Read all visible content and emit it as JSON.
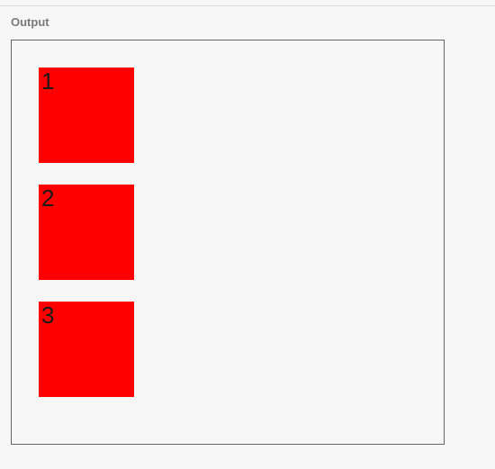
{
  "panel": {
    "label": "Output"
  },
  "boxes": {
    "item1": {
      "label": "1"
    },
    "item2": {
      "label": "2"
    },
    "item3": {
      "label": "3"
    }
  },
  "colors": {
    "box_bg": "#ff0000",
    "page_bg": "#f6f6f6",
    "frame_border": "#666666"
  }
}
